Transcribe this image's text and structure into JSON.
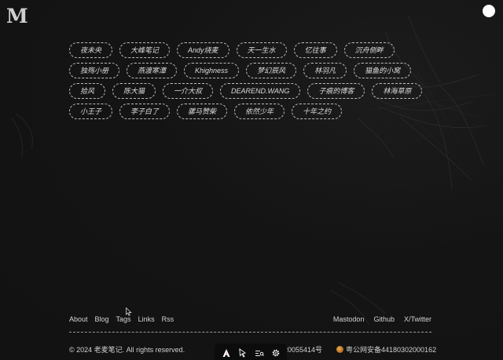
{
  "site": {
    "logo": "M"
  },
  "friend_links": [
    "夜未央",
    "大峰笔记",
    "Andy烧麦",
    "天一生水",
    "忆往事",
    "沉舟侧畔",
    "独殇小册",
    "燕渡寒潭",
    "Khighness",
    "梦幻辰风",
    "林羽凡",
    "猫鱼的小窝",
    "拾风",
    "陈大猫",
    "一介大叔",
    "DEAREND.WANG",
    "子痕的博客",
    "林海草原",
    "小王子",
    "李子白了",
    "骡马赞柴",
    "依然少年",
    "十年之约"
  ],
  "footer": {
    "nav_left": [
      "About",
      "Blog",
      "Tags",
      "Links",
      "Rss"
    ],
    "nav_right": [
      "Mastodon",
      "Github",
      "X/Twitter"
    ],
    "copyright": "© 2024 老麦笔记. All rights reserved.",
    "icp": "备20055414号",
    "police": "粤公网安备44180302000162"
  },
  "toolbar": {
    "icons": [
      "cursor-a-icon",
      "pointer-select-icon",
      "inspect-list-icon",
      "settings-gear-icon"
    ]
  }
}
